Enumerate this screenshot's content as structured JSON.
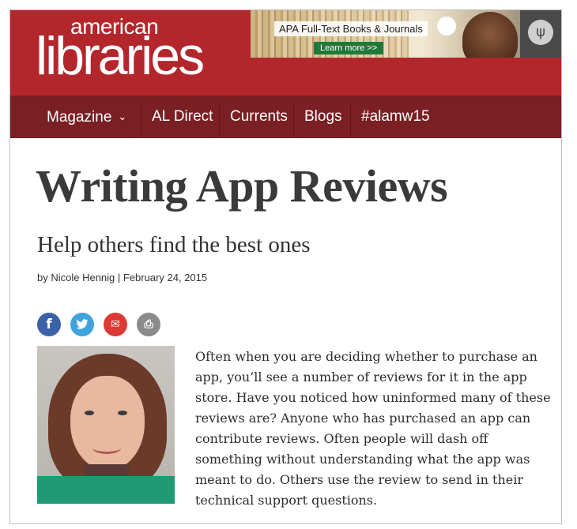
{
  "header": {
    "logo_top": "american",
    "logo_bottom": "libraries",
    "ad": {
      "title": "APA Full-Text Books & Journals",
      "cta": "Learn more >>"
    },
    "colors": {
      "brand_red": "#b3262c",
      "nav_dark": "#7a1f24"
    }
  },
  "nav": {
    "items": [
      {
        "label": "Magazine",
        "has_dropdown": true
      },
      {
        "label": "AL Direct"
      },
      {
        "label": "Currents"
      },
      {
        "label": "Blogs"
      },
      {
        "label": "#alamw15"
      }
    ],
    "dropdown_icon": "chevron-down-icon"
  },
  "article": {
    "title": "Writing App Reviews",
    "subtitle": "Help others find the best ones",
    "byline": "by Nicole Hennig | February 24, 2015",
    "share": [
      {
        "icon": "facebook-icon",
        "glyph": "f"
      },
      {
        "icon": "twitter-icon",
        "glyph": "t"
      },
      {
        "icon": "email-icon",
        "glyph": "✉"
      },
      {
        "icon": "print-icon",
        "glyph": "⎙"
      }
    ],
    "body": "Often when you are deciding whether to purchase an app, you’ll see a number of reviews for it in the app store. Have you noticed how uninformed many of these reviews are? Anyone who has purchased an app can contribute reviews. Often people will dash off something without understanding what the app was meant to do. Others use the review to send in their technical support questions."
  }
}
